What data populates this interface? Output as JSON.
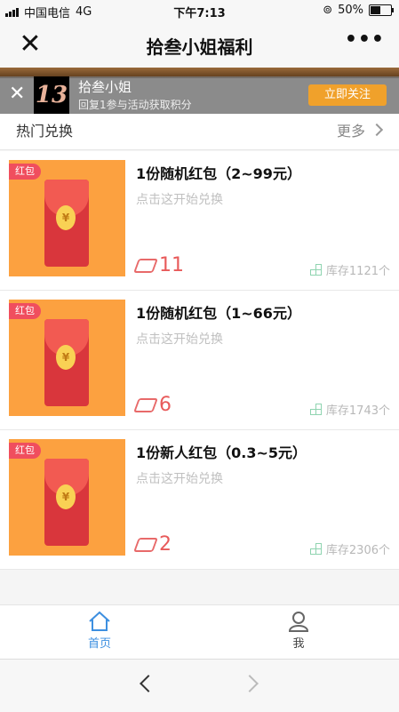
{
  "status_bar": {
    "carrier": "中国电信",
    "network": "4G",
    "time": "下午7:13",
    "battery_percent": "50%",
    "battery_level": 0.5
  },
  "nav": {
    "title": "拾叁小姐福利",
    "close_icon": "close-icon",
    "more_icon": "more-icon"
  },
  "follow_banner": {
    "logo_text": "13",
    "name": "拾叁小姐",
    "desc": "回复1参与活动获取积分",
    "button": "立即关注"
  },
  "section": {
    "title": "热门兑换",
    "more": "更多"
  },
  "items": [
    {
      "tag": "红包",
      "title": "1份随机红包（2~99元）",
      "sub": "点击这开始兑换",
      "price": "11",
      "stock": "库存1121个"
    },
    {
      "tag": "红包",
      "title": "1份随机红包（1~66元）",
      "sub": "点击这开始兑换",
      "price": "6",
      "stock": "库存1743个"
    },
    {
      "tag": "红包",
      "title": "1份新人红包（0.3~5元）",
      "sub": "点击这开始兑换",
      "price": "2",
      "stock": "库存2306个"
    }
  ],
  "tabbar": {
    "home": "首页",
    "me": "我"
  },
  "colors": {
    "accent": "#3d8fe0",
    "price": "#e85a5a",
    "thumb_bg": "#fca140",
    "follow_button": "#f0a12b"
  }
}
